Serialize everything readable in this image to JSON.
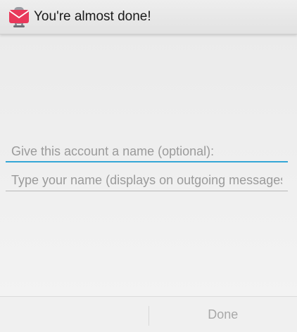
{
  "app": {
    "title": "You're almost done!",
    "icon": "k9-mail-envelope-icon",
    "icon_color": "#e8385a"
  },
  "form": {
    "account_name_placeholder": "Give this account a name (optional):",
    "account_name_value": "",
    "your_name_placeholder": "Type your name (displays on outgoing messages):",
    "your_name_value": "",
    "focus_color": "#33a6d6"
  },
  "footer": {
    "left_label": "",
    "done_label": "Done"
  }
}
